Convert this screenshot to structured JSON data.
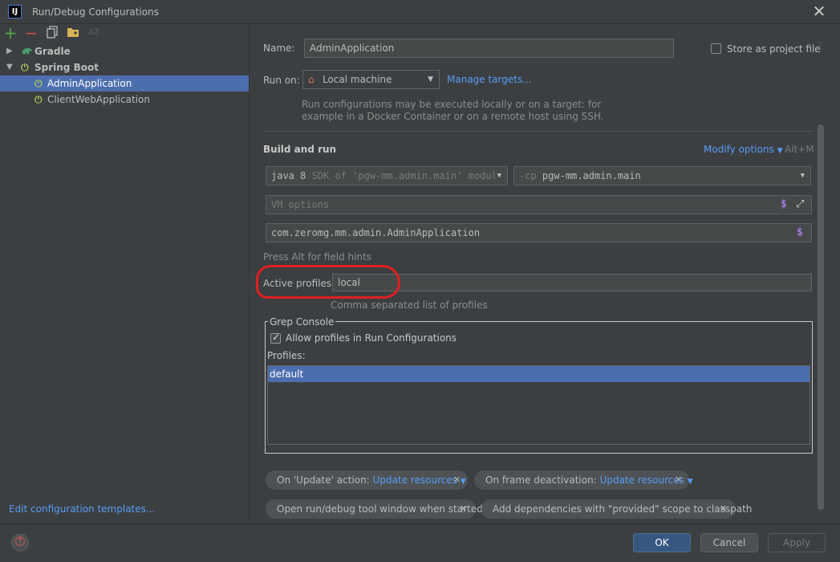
{
  "window": {
    "title": "Run/Debug Configurations",
    "logo_text": "IJ",
    "close_glyph": "✕"
  },
  "toolbar": {
    "add_glyph": "+",
    "remove_glyph": "−",
    "sort_glyph": "AZ"
  },
  "tree": {
    "gradle_label": "Gradle",
    "springboot_label": "Spring Boot",
    "items": [
      {
        "label": "AdminApplication"
      },
      {
        "label": "ClientWebApplication"
      }
    ]
  },
  "left_link": "Edit configuration templates...",
  "form": {
    "name_label": "Name:",
    "name_value": "AdminApplication",
    "store_label": "Store as project file",
    "run_on_label": "Run on:",
    "run_on_value": "Local machine",
    "manage_targets": "Manage targets...",
    "run_on_desc_1": "Run configurations may be executed locally or on a target: for",
    "run_on_desc_2": "example in a Docker Container or on a remote host using SSH.",
    "build_run_heading": "Build and run",
    "modify_options": "Modify options",
    "modify_shortcut": "Alt+M",
    "jdk_prefix": "java 8",
    "jdk_suffix": "SDK of 'pgw-mm.admin.main' modul",
    "cp_prefix": "-cp",
    "cp_value": "pgw-mm.admin.main",
    "vm_placeholder": "VM options",
    "main_class": "com.zeromg.mm.admin.AdminApplication",
    "alt_hint": "Press Alt for field hints",
    "profiles_label": "Active profiles:",
    "profiles_value": "local",
    "profiles_hint": "Comma separated list of profiles",
    "grep_title": "Grep Console",
    "allow_profiles": "Allow profiles in Run Configurations",
    "profiles_list_label": "Profiles:",
    "profiles_list": [
      "default"
    ]
  },
  "chips": {
    "update_label": "On 'Update' action:",
    "update_value": "Update resources",
    "deactivate_label": "On frame deactivation:",
    "deactivate_value": "Update resources",
    "open_tool_window": "Open run/debug tool window when started",
    "add_deps": "Add dependencies with \"provided\" scope to classpath"
  },
  "buttons": {
    "ok": "OK",
    "cancel": "Cancel",
    "apply": "Apply",
    "help": "?"
  },
  "colors": {
    "accent": "#589df6",
    "selection": "#4b6eaf",
    "primary_button": "#365880",
    "annotation": "#e02020"
  }
}
